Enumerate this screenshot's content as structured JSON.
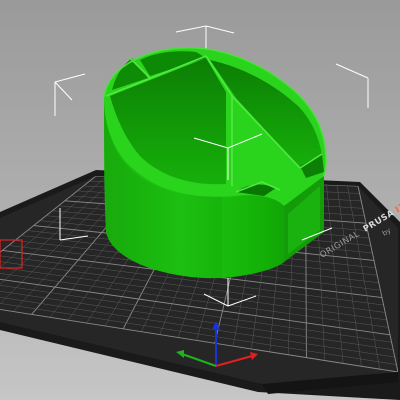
{
  "viewport": {
    "background_top": "#9a9a9a",
    "background_bottom": "#c6c6c6"
  },
  "bed": {
    "surface_color": "#262626",
    "edge_color": "#1a1a1a",
    "grid_color": "#5a5a5a",
    "grid_major_color": "#8a8a8a",
    "brand_prefix": "ORIGINAL",
    "brand_name": "PRUSA",
    "brand_suffix": "I3",
    "brand_tail": "by",
    "brand_accent_color": "#fa6831",
    "origin_marker_color": "#e02020"
  },
  "model": {
    "name": "pen-holder-model",
    "color_main": "#16c20a",
    "color_light": "#3ee22d",
    "color_dark": "#0e8c05",
    "color_edge": "#0a6a03"
  },
  "axes": {
    "x_color": "#e02020",
    "y_color": "#1fb31f",
    "z_color": "#1a33d9"
  },
  "selection": {
    "corner_color": "#ffffff"
  }
}
